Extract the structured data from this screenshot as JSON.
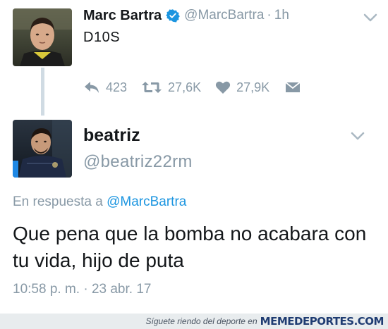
{
  "original_tweet": {
    "display_name": "Marc Bartra",
    "handle": "@MarcBartra",
    "separator": "·",
    "time": "1h",
    "text": "D10S",
    "reply_count": "423",
    "retweet_count": "27,6K",
    "like_count": "27,9K",
    "verified": true
  },
  "reply_tweet": {
    "display_name": "beatriz",
    "handle": "@beatriz22rm",
    "reply_prefix": "En respuesta a",
    "reply_mention": "@MarcBartra",
    "text": "Que pena que la bomba no acabara con tu vida, hijo de puta",
    "timestamp": "10:58 p. m. · 23 abr. 17"
  },
  "footer": {
    "tagline": "Síguete riendo del deporte en",
    "brand": "MEMEDEPORTES.COM"
  },
  "colors": {
    "accent": "#1b95e0",
    "muted": "#8899a6",
    "text": "#14171a",
    "thread_line": "#d0dbe3",
    "footer_bg": "#e8ecee",
    "brand": "#1f3c72"
  },
  "icons": {
    "reply": "reply-arrow-icon",
    "retweet": "retweet-icon",
    "like": "heart-icon",
    "dm": "envelope-icon",
    "verified": "verified-badge-icon",
    "menu": "chevron-down-icon"
  }
}
